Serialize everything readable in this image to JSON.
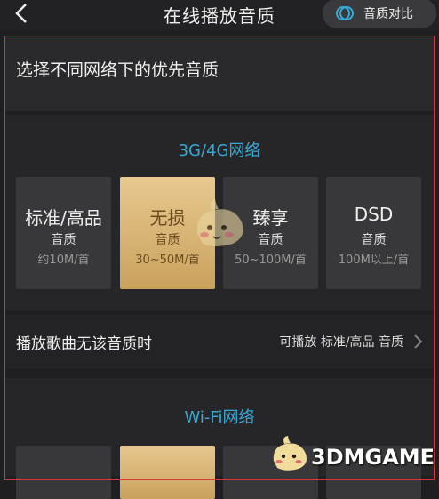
{
  "header": {
    "title": "在线播放音质",
    "compare_label": "音质对比",
    "back_icon": "chevron-left-icon",
    "compare_icon": "overlap-circles-icon"
  },
  "subtitle": "选择不同网络下的优先音质",
  "mobile": {
    "title": "3G/4G网络",
    "cards": [
      {
        "name": "标准/高品",
        "q": "音质",
        "size": "约10M/首",
        "selected": false
      },
      {
        "name": "无损",
        "q": "音质",
        "size": "30~50M/首",
        "selected": true
      },
      {
        "name": "臻享",
        "q": "音质",
        "size": "50~100M/首",
        "selected": false
      },
      {
        "name": "DSD",
        "q": "音质",
        "size": "100M以上/首",
        "selected": false
      }
    ]
  },
  "fallback": {
    "label": "播放歌曲无该音质时",
    "value": "可播放 标准/高品 音质"
  },
  "wifi": {
    "title": "Wi-Fi网络"
  },
  "watermark": {
    "text": "3DMGAME"
  },
  "colors": {
    "accent": "#37a9d6",
    "selected_gold": "#d9b476",
    "highlight_border": "#d23a3a"
  }
}
